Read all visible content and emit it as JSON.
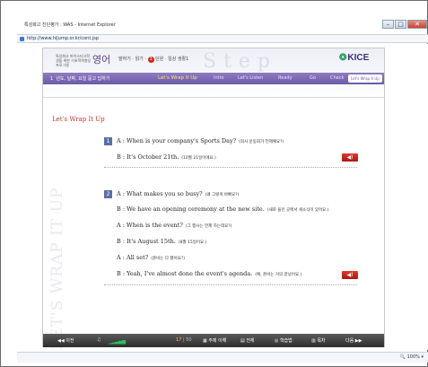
{
  "window": {
    "title": "특성화고 진단평가 : WAS - Internet Explorer",
    "address": "http://www.hijump.or.kr/cont.jsp",
    "zoom": "100%",
    "buttons": {
      "minimize": "–",
      "maximize": "□",
      "close": "✕"
    }
  },
  "header": {
    "brand_small": "특성화고 마이스터고학생을 위한 기초학력향상프로그램",
    "brand_big": "영어",
    "unit_prefix": "말하기 · 읽기 ·",
    "unit_num": "3",
    "unit_suffix": "단원 · 일상 생활1",
    "deco": "Step",
    "logo": "KICE"
  },
  "nav": {
    "number": "1",
    "title": "년도, 날짜, 요일 묻고 답하기",
    "current": "Let's Wrap It Up",
    "tabs": [
      "Intro",
      "Let's Listen",
      "Ready",
      "Go",
      "Check",
      "Let's Wrap It Up"
    ]
  },
  "section": {
    "title": "Let's Wrap It Up",
    "watermark": "LET'S WRAP IT UP"
  },
  "exercise1": {
    "number": "1",
    "lines": [
      {
        "en": "A : When is your company's Sports Day?",
        "ko": "(회사 운동회가 언제예요?)"
      },
      {
        "en": "B : It's October 21th.",
        "ko": "(10월 21일이에요.)"
      }
    ]
  },
  "exercise2": {
    "number": "2",
    "lines": [
      {
        "en": "A : What makes you so busy?",
        "ko": "(왜 그렇게 바빠요?)"
      },
      {
        "en": "B : We have an opening ceremony at the new site.",
        "ko": "(새로 들인 곳에서 세소식이 있어요.)"
      },
      {
        "en": "A : When is the event?",
        "ko": "(그 행사는 언제 하는데요?)"
      },
      {
        "en": "B : It's August 15th.",
        "ko": "(8월 15일이요.)"
      },
      {
        "en": "A : All set?",
        "ko": "(준비는 다 됐어요?)"
      },
      {
        "en": "B : Yeah, I've almost done the event's agenda.",
        "ko": "(예, 준비는 거의 끝났어요.)"
      }
    ]
  },
  "audio": {
    "icon": "speaker-icon",
    "glyph": "◀)"
  },
  "footer": {
    "prev": "◀◀ 이전",
    "volume": "♫",
    "volume_bars": "▁▂▃▄▅",
    "page_current": "17",
    "page_sep": " | ",
    "page_total": "50",
    "f1": "▦ 주제 이해",
    "f2": "▤ 전체",
    "f3": "◎ 학습법",
    "f4": "▥ 목차",
    "next": "다음 ▶▶"
  },
  "colors": {
    "accent": "#6b5aa8",
    "audio": "#d0231c",
    "title": "#c0392b"
  }
}
